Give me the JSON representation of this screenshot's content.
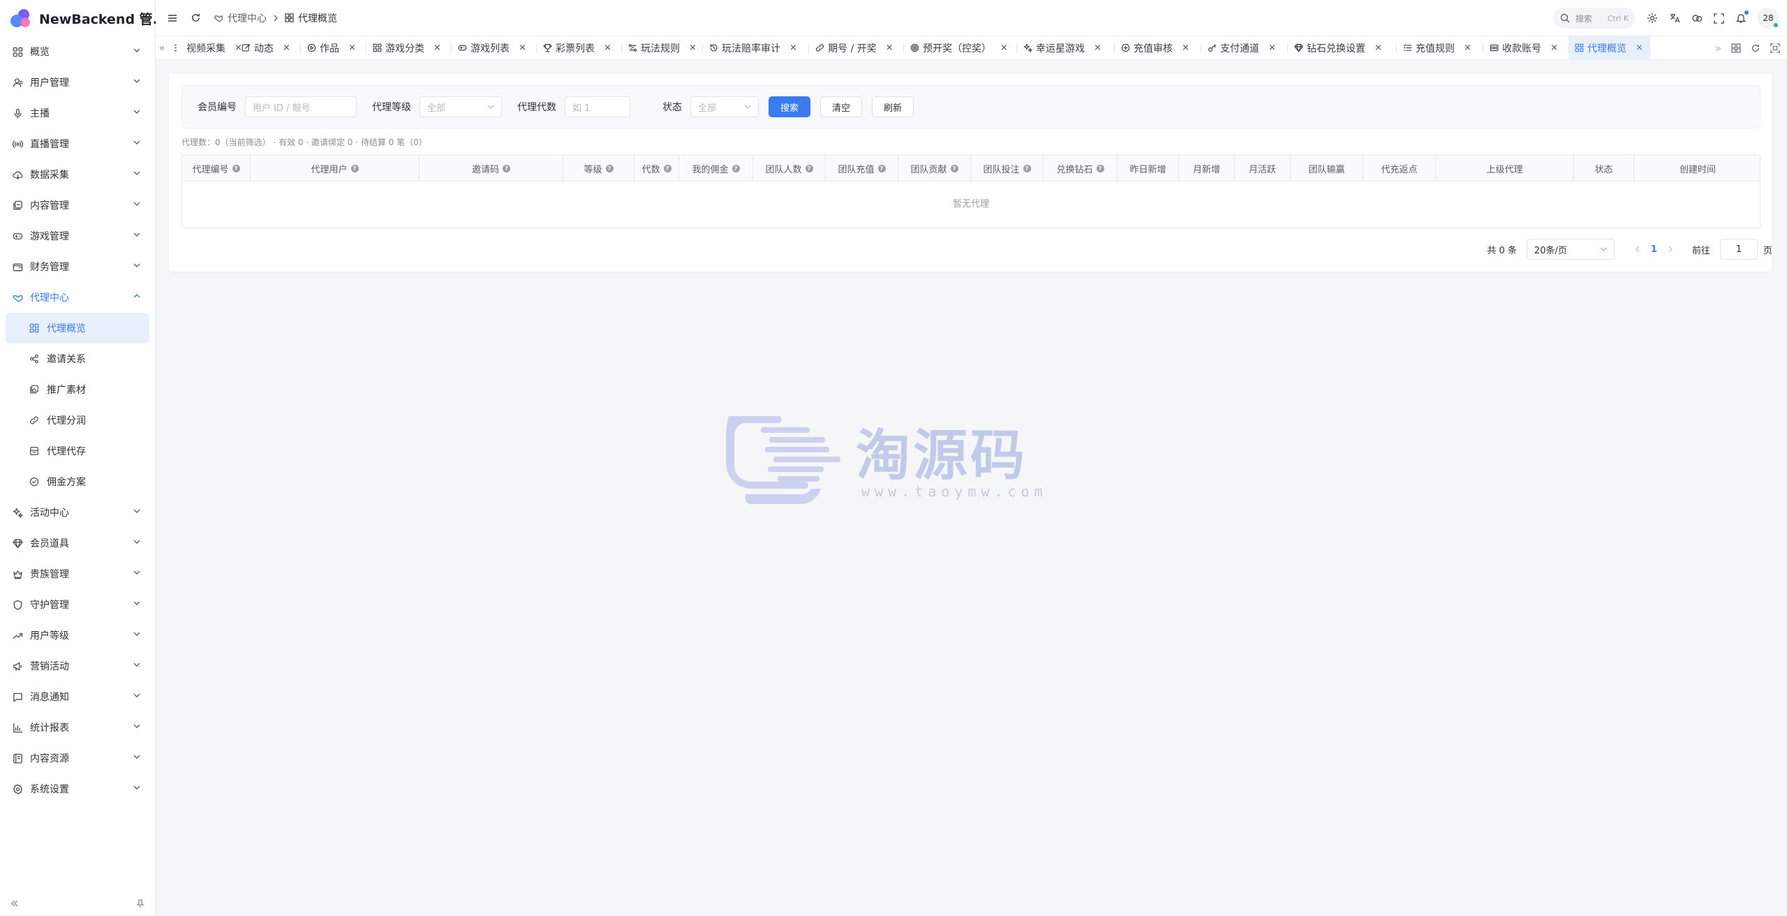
{
  "app": {
    "title": "NewBackend 管..."
  },
  "sidebar": {
    "items": [
      {
        "label": "概览",
        "icon": "dashboard-icon"
      },
      {
        "label": "用户管理",
        "icon": "user-icon"
      },
      {
        "label": "主播",
        "icon": "mic-icon"
      },
      {
        "label": "直播管理",
        "icon": "broadcast-icon"
      },
      {
        "label": "数据采集",
        "icon": "cloud-download-icon"
      },
      {
        "label": "内容管理",
        "icon": "content-icon"
      },
      {
        "label": "游戏管理",
        "icon": "gamepad-icon"
      },
      {
        "label": "财务管理",
        "icon": "wallet-icon"
      },
      {
        "label": "代理中心",
        "icon": "handshake-icon"
      }
    ],
    "agent_sub": [
      {
        "label": "代理概览",
        "icon": "grid-icon"
      },
      {
        "label": "邀请关系",
        "icon": "share-icon"
      },
      {
        "label": "推广素材",
        "icon": "images-icon"
      },
      {
        "label": "代理分润",
        "icon": "link-icon"
      },
      {
        "label": "代理代存",
        "icon": "box-icon"
      },
      {
        "label": "佣金方案",
        "icon": "check-circle-icon"
      }
    ],
    "items_after": [
      {
        "label": "活动中心",
        "icon": "sparkle-icon"
      },
      {
        "label": "会员道具",
        "icon": "diamond-icon"
      },
      {
        "label": "贵族管理",
        "icon": "crown-icon"
      },
      {
        "label": "守护管理",
        "icon": "shield-icon"
      },
      {
        "label": "用户等级",
        "icon": "trend-icon"
      },
      {
        "label": "营销活动",
        "icon": "megaphone-icon"
      },
      {
        "label": "消息通知",
        "icon": "message-icon"
      },
      {
        "label": "统计报表",
        "icon": "chart-icon"
      },
      {
        "label": "内容资源",
        "icon": "archive-icon"
      },
      {
        "label": "系统设置",
        "icon": "gear-icon"
      }
    ]
  },
  "breadcrumb": {
    "parent": "代理中心",
    "current": "代理概览"
  },
  "topbar": {
    "search_placeholder": "搜索",
    "search_shortcut": "Ctrl K",
    "avatar_text": "28"
  },
  "tabs": [
    {
      "label": "视频采集",
      "icon": "video-icon"
    },
    {
      "label": "动态",
      "icon": "edit-icon"
    },
    {
      "label": "作品",
      "icon": "play-circle-icon"
    },
    {
      "label": "游戏分类",
      "icon": "grid-icon"
    },
    {
      "label": "游戏列表",
      "icon": "gamepad-icon"
    },
    {
      "label": "彩票列表",
      "icon": "trophy-icon"
    },
    {
      "label": "玩法规则",
      "icon": "rules-icon"
    },
    {
      "label": "玩法赔率审计",
      "icon": "history-icon"
    },
    {
      "label": "期号 / 开奖",
      "icon": "link-icon"
    },
    {
      "label": "预开奖（控奖）",
      "icon": "target-icon"
    },
    {
      "label": "幸运星游戏",
      "icon": "sparkle-icon"
    },
    {
      "label": "充值审核",
      "icon": "plus-circle-icon"
    },
    {
      "label": "支付通道",
      "icon": "key-icon"
    },
    {
      "label": "钻石兑换设置",
      "icon": "diamond-icon"
    },
    {
      "label": "充值规则",
      "icon": "list-icon"
    },
    {
      "label": "收款账号",
      "icon": "card-icon"
    },
    {
      "label": "代理概览",
      "icon": "grid-icon",
      "active": true
    }
  ],
  "filters": {
    "member_label": "会员编号",
    "member_placeholder": "用户 ID / 靓号",
    "level_label": "代理等级",
    "level_value": "全部",
    "gen_label": "代理代数",
    "gen_placeholder": "如 1",
    "status_label": "状态",
    "status_value": "全部",
    "search_btn": "搜索",
    "clear_btn": "清空",
    "refresh_btn": "刷新"
  },
  "summary": "代理数：0（当前筛选） · 有效 0 · 邀请绑定 0 · 待结算 0 笔（0）",
  "table": {
    "columns": [
      {
        "label": "代理编号",
        "help": true
      },
      {
        "label": "代理用户",
        "help": true
      },
      {
        "label": "邀请码",
        "help": true
      },
      {
        "label": "等级",
        "help": true
      },
      {
        "label": "代数",
        "help": true
      },
      {
        "label": "我的佣金",
        "help": true
      },
      {
        "label": "团队人数",
        "help": true
      },
      {
        "label": "团队充值",
        "help": true
      },
      {
        "label": "团队贡献",
        "help": true
      },
      {
        "label": "团队投注",
        "help": true
      },
      {
        "label": "兑换钻石",
        "help": true
      },
      {
        "label": "昨日新增",
        "help": false
      },
      {
        "label": "月新增",
        "help": false
      },
      {
        "label": "月活跃",
        "help": false
      },
      {
        "label": "团队输赢",
        "help": false
      },
      {
        "label": "代充返点",
        "help": false
      },
      {
        "label": "上级代理",
        "help": false
      },
      {
        "label": "状态",
        "help": false
      },
      {
        "label": "创建时间",
        "help": false
      }
    ],
    "empty_text": "暂无代理"
  },
  "pagination": {
    "total": "共 0 条",
    "page_size": "20条/页",
    "current_page": "1",
    "goto_label": "前往",
    "goto_value": "1",
    "page_suffix": "页"
  },
  "watermark": {
    "text": "淘源码",
    "url": "www.taoymw.com"
  },
  "colors": {
    "accent": "#3a7bf0",
    "active_bg": "#e9f0fd"
  }
}
